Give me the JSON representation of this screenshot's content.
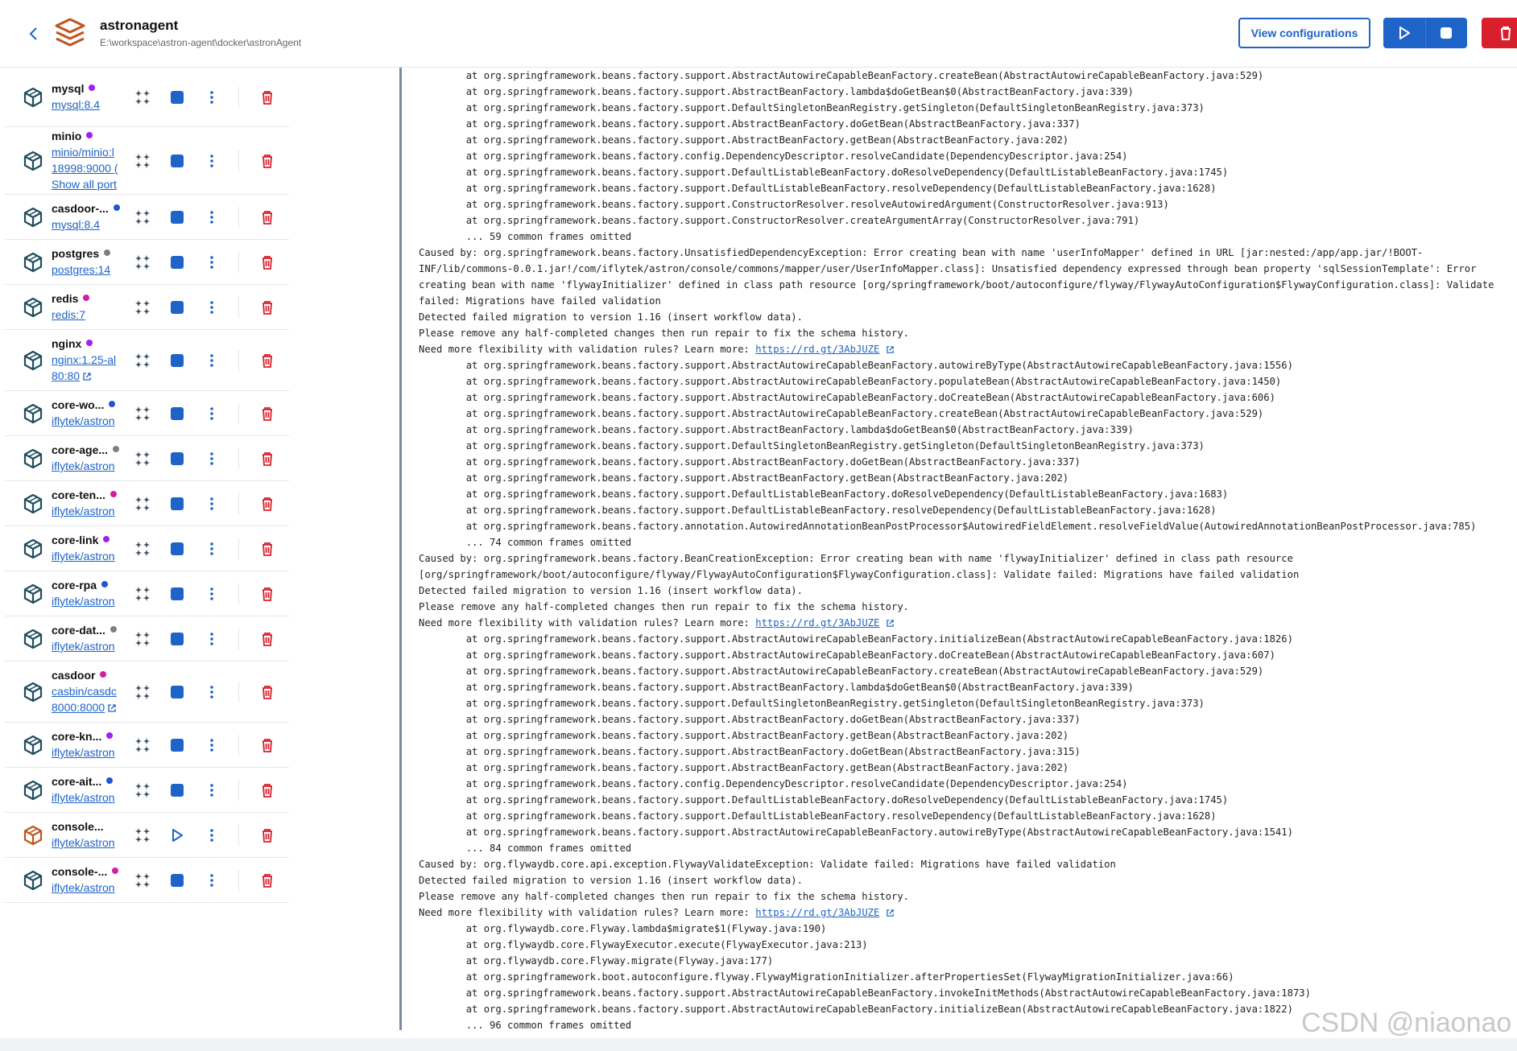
{
  "header": {
    "app_name": "astronagent",
    "app_path": "E:\\workspace\\astron-agent\\docker\\astronAgent",
    "view_config_label": "View configurations"
  },
  "colors": {
    "accent": "#1d63c8",
    "danger": "#d91f2b",
    "dot_purple": "#a020f0",
    "dot_blue": "#1f55d6",
    "dot_gray": "#7a7f88",
    "dot_magenta": "#d01ea8"
  },
  "containers": [
    {
      "name": "mysql",
      "dot": "purple",
      "links": [
        "mysql:8.4"
      ],
      "state": "running"
    },
    {
      "name": "minio",
      "dot": "purple",
      "links": [
        "minio/minio:l",
        "18998:9000 (",
        "Show all port"
      ],
      "state": "running"
    },
    {
      "name": "casdoor-...",
      "dot": "blue",
      "links": [
        "mysql:8.4"
      ],
      "state": "running"
    },
    {
      "name": "postgres",
      "dot": "gray",
      "links": [
        "postgres:14"
      ],
      "state": "running"
    },
    {
      "name": "redis",
      "dot": "magenta",
      "links": [
        "redis:7"
      ],
      "state": "running"
    },
    {
      "name": "nginx",
      "dot": "purple",
      "links": [
        "nginx:1.25-al",
        "80:80"
      ],
      "state": "running"
    },
    {
      "name": "core-wo...",
      "dot": "blue",
      "links": [
        "iflytek/astron"
      ],
      "state": "running"
    },
    {
      "name": "core-age...",
      "dot": "gray",
      "links": [
        "iflytek/astron"
      ],
      "state": "running"
    },
    {
      "name": "core-ten...",
      "dot": "magenta",
      "links": [
        "iflytek/astron"
      ],
      "state": "running"
    },
    {
      "name": "core-link",
      "dot": "purple",
      "links": [
        "iflytek/astron"
      ],
      "state": "running"
    },
    {
      "name": "core-rpa",
      "dot": "blue",
      "links": [
        "iflytek/astron"
      ],
      "state": "running"
    },
    {
      "name": "core-dat...",
      "dot": "gray",
      "links": [
        "iflytek/astron"
      ],
      "state": "running"
    },
    {
      "name": "casdoor",
      "dot": "magenta",
      "links": [
        "casbin/casdc",
        "8000:8000"
      ],
      "state": "running"
    },
    {
      "name": "core-kn...",
      "dot": "purple",
      "links": [
        "iflytek/astron"
      ],
      "state": "running"
    },
    {
      "name": "core-ait...",
      "dot": "blue",
      "links": [
        "iflytek/astron"
      ],
      "state": "running"
    },
    {
      "name": "console...",
      "dot": "none",
      "links": [
        "iflytek/astron"
      ],
      "state": "stopped"
    },
    {
      "name": "console-...",
      "dot": "magenta",
      "links": [
        "iflytek/astron"
      ],
      "state": "running"
    }
  ],
  "log_lines": [
    "        at org.springframework.beans.factory.support.AbstractAutowireCapableBeanFactory.createBean(AbstractAutowireCapableBeanFactory.java:529)",
    "        at org.springframework.beans.factory.support.AbstractBeanFactory.lambda$doGetBean$0(AbstractBeanFactory.java:339)",
    "        at org.springframework.beans.factory.support.DefaultSingletonBeanRegistry.getSingleton(DefaultSingletonBeanRegistry.java:373)",
    "        at org.springframework.beans.factory.support.AbstractBeanFactory.doGetBean(AbstractBeanFactory.java:337)",
    "        at org.springframework.beans.factory.support.AbstractBeanFactory.getBean(AbstractBeanFactory.java:202)",
    "        at org.springframework.beans.factory.config.DependencyDescriptor.resolveCandidate(DependencyDescriptor.java:254)",
    "        at org.springframework.beans.factory.support.DefaultListableBeanFactory.doResolveDependency(DefaultListableBeanFactory.java:1745)",
    "        at org.springframework.beans.factory.support.DefaultListableBeanFactory.resolveDependency(DefaultListableBeanFactory.java:1628)",
    "        at org.springframework.beans.factory.support.ConstructorResolver.resolveAutowiredArgument(ConstructorResolver.java:913)",
    "        at org.springframework.beans.factory.support.ConstructorResolver.createArgumentArray(ConstructorResolver.java:791)",
    "        ... 59 common frames omitted",
    "Caused by: org.springframework.beans.factory.UnsatisfiedDependencyException: Error creating bean with name 'userInfoMapper' defined in URL [jar:nested:/app/app.jar/!BOOT-",
    "INF/lib/commons-0.0.1.jar!/com/iflytek/astron/console/commons/mapper/user/UserInfoMapper.class]: Unsatisfied dependency expressed through bean property 'sqlSessionTemplate': Error",
    "creating bean with name 'flywayInitializer' defined in class path resource [org/springframework/boot/autoconfigure/flyway/FlywayAutoConfiguration$FlywayConfiguration.class]: Validate",
    "failed: Migrations have failed validation",
    "Detected failed migration to version 1.16 (insert workflow data).",
    "Please remove any half-completed changes then run repair to fix the schema history.",
    "Need more flexibility with validation rules? Learn more: {LINK}",
    "        at org.springframework.beans.factory.support.AbstractAutowireCapableBeanFactory.autowireByType(AbstractAutowireCapableBeanFactory.java:1556)",
    "        at org.springframework.beans.factory.support.AbstractAutowireCapableBeanFactory.populateBean(AbstractAutowireCapableBeanFactory.java:1450)",
    "        at org.springframework.beans.factory.support.AbstractAutowireCapableBeanFactory.doCreateBean(AbstractAutowireCapableBeanFactory.java:606)",
    "        at org.springframework.beans.factory.support.AbstractAutowireCapableBeanFactory.createBean(AbstractAutowireCapableBeanFactory.java:529)",
    "        at org.springframework.beans.factory.support.AbstractBeanFactory.lambda$doGetBean$0(AbstractBeanFactory.java:339)",
    "        at org.springframework.beans.factory.support.DefaultSingletonBeanRegistry.getSingleton(DefaultSingletonBeanRegistry.java:373)",
    "        at org.springframework.beans.factory.support.AbstractBeanFactory.doGetBean(AbstractBeanFactory.java:337)",
    "        at org.springframework.beans.factory.support.AbstractBeanFactory.getBean(AbstractBeanFactory.java:202)",
    "        at org.springframework.beans.factory.support.DefaultListableBeanFactory.doResolveDependency(DefaultListableBeanFactory.java:1683)",
    "        at org.springframework.beans.factory.support.DefaultListableBeanFactory.resolveDependency(DefaultListableBeanFactory.java:1628)",
    "        at org.springframework.beans.factory.annotation.AutowiredAnnotationBeanPostProcessor$AutowiredFieldElement.resolveFieldValue(AutowiredAnnotationBeanPostProcessor.java:785)",
    "        ... 74 common frames omitted",
    "Caused by: org.springframework.beans.factory.BeanCreationException: Error creating bean with name 'flywayInitializer' defined in class path resource",
    "[org/springframework/boot/autoconfigure/flyway/FlywayAutoConfiguration$FlywayConfiguration.class]: Validate failed: Migrations have failed validation",
    "Detected failed migration to version 1.16 (insert workflow data).",
    "Please remove any half-completed changes then run repair to fix the schema history.",
    "Need more flexibility with validation rules? Learn more: {LINK}",
    "        at org.springframework.beans.factory.support.AbstractAutowireCapableBeanFactory.initializeBean(AbstractAutowireCapableBeanFactory.java:1826)",
    "        at org.springframework.beans.factory.support.AbstractAutowireCapableBeanFactory.doCreateBean(AbstractAutowireCapableBeanFactory.java:607)",
    "        at org.springframework.beans.factory.support.AbstractAutowireCapableBeanFactory.createBean(AbstractAutowireCapableBeanFactory.java:529)",
    "        at org.springframework.beans.factory.support.AbstractBeanFactory.lambda$doGetBean$0(AbstractBeanFactory.java:339)",
    "        at org.springframework.beans.factory.support.DefaultSingletonBeanRegistry.getSingleton(DefaultSingletonBeanRegistry.java:373)",
    "        at org.springframework.beans.factory.support.AbstractBeanFactory.doGetBean(AbstractBeanFactory.java:337)",
    "        at org.springframework.beans.factory.support.AbstractBeanFactory.getBean(AbstractBeanFactory.java:202)",
    "        at org.springframework.beans.factory.support.AbstractBeanFactory.doGetBean(AbstractBeanFactory.java:315)",
    "        at org.springframework.beans.factory.support.AbstractBeanFactory.getBean(AbstractBeanFactory.java:202)",
    "        at org.springframework.beans.factory.config.DependencyDescriptor.resolveCandidate(DependencyDescriptor.java:254)",
    "        at org.springframework.beans.factory.support.DefaultListableBeanFactory.doResolveDependency(DefaultListableBeanFactory.java:1745)",
    "        at org.springframework.beans.factory.support.DefaultListableBeanFactory.resolveDependency(DefaultListableBeanFactory.java:1628)",
    "        at org.springframework.beans.factory.support.AbstractAutowireCapableBeanFactory.autowireByType(AbstractAutowireCapableBeanFactory.java:1541)",
    "        ... 84 common frames omitted",
    "Caused by: org.flywaydb.core.api.exception.FlywayValidateException: Validate failed: Migrations have failed validation",
    "Detected failed migration to version 1.16 (insert workflow data).",
    "Please remove any half-completed changes then run repair to fix the schema history.",
    "Need more flexibility with validation rules? Learn more: {LINK}",
    "        at org.flywaydb.core.Flyway.lambda$migrate$1(Flyway.java:190)",
    "        at org.flywaydb.core.FlywayExecutor.execute(FlywayExecutor.java:213)",
    "        at org.flywaydb.core.Flyway.migrate(Flyway.java:177)",
    "        at org.springframework.boot.autoconfigure.flyway.FlywayMigrationInitializer.afterPropertiesSet(FlywayMigrationInitializer.java:66)",
    "        at org.springframework.beans.factory.support.AbstractAutowireCapableBeanFactory.invokeInitMethods(AbstractAutowireCapableBeanFactory.java:1873)",
    "        at org.springframework.beans.factory.support.AbstractAutowireCapableBeanFactory.initializeBean(AbstractAutowireCapableBeanFactory.java:1822)",
    "        ... 96 common frames omitted"
  ],
  "log_link": "https://rd.gt/3AbJUZE",
  "watermark": "CSDN @niaonao",
  "icons": {
    "back": "chevron-left-icon",
    "logo": "stack-layers-icon",
    "container": "cube-icon",
    "inspect": "sparkle-dots-icon",
    "stop": "stop-square-icon",
    "start": "play-icon",
    "more": "kebab-menu-icon",
    "delete": "trash-icon",
    "external": "external-link-icon"
  }
}
